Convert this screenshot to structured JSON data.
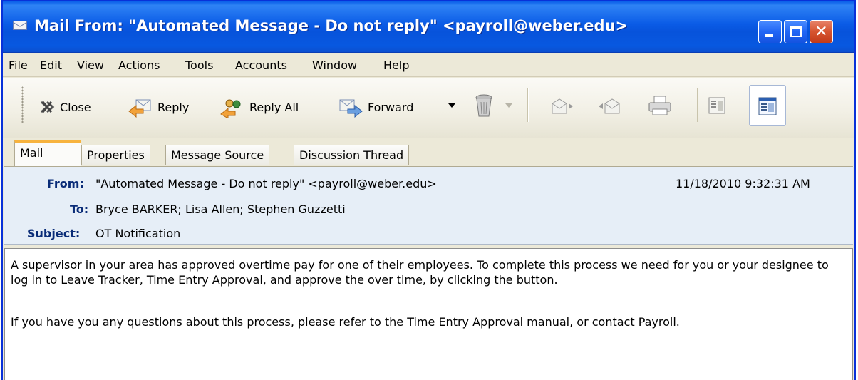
{
  "window": {
    "title": "Mail From: \"Automated Message - Do not reply\" <payroll@weber.edu>",
    "title_icon": "envelope-icon",
    "controls": [
      "minimize",
      "maximize",
      "close"
    ]
  },
  "menu": {
    "items": [
      "File",
      "Edit",
      "View",
      "Actions",
      "Tools",
      "Accounts",
      "Window",
      "Help"
    ]
  },
  "toolbar": {
    "close_label": "Close",
    "reply_label": "Reply",
    "reply_all_label": "Reply All",
    "forward_label": "Forward",
    "icons": [
      "close-x-icon",
      "reply-icon",
      "reply-all-icon",
      "forward-icon",
      "trash-icon",
      "next-message-icon",
      "previous-message-icon",
      "print-icon",
      "headers-view-icon",
      "message-view-icon"
    ]
  },
  "tabs": [
    "Mail",
    "Properties",
    "Message Source",
    "Discussion Thread"
  ],
  "header": {
    "from_label": "From:",
    "from_value": "\"Automated Message - Do not reply\" <payroll@weber.edu>",
    "date": "11/18/2010 9:32:31 AM",
    "to_label": "To:",
    "to_value": "Bryce BARKER; Lisa Allen; Stephen Guzzetti",
    "subject_label": "Subject:",
    "subject_value": "OT Notification"
  },
  "body": {
    "paragraph1": "A supervisor in your area has approved overtime pay for one of their employees.  To complete this process we need for you or your designee to log in to Leave Tracker, Time Entry Approval, and approve the over time, by clicking the button.",
    "paragraph2": "If you have you any questions about this process, please refer to the Time Entry Approval manual, or contact Payroll."
  },
  "colors": {
    "titlebar_blue": "#0a5be6",
    "close_red": "#d6542f",
    "active_tab_accent": "#f7b33e",
    "header_bg": "#e6eef7",
    "header_label": "#0a2c78"
  }
}
